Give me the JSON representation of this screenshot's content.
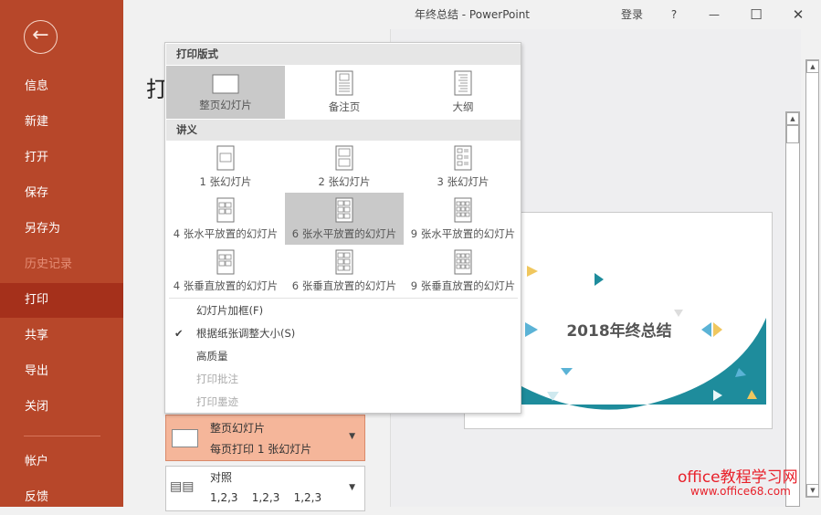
{
  "window": {
    "title": "年终总结  -  PowerPoint",
    "login": "登录",
    "help": "?",
    "minimize": "—",
    "maximize": "☐",
    "close": "✕"
  },
  "sidebar": {
    "back_icon": "arrow-left-icon",
    "items": [
      {
        "label": "信息",
        "state": "normal"
      },
      {
        "label": "新建",
        "state": "normal"
      },
      {
        "label": "打开",
        "state": "normal"
      },
      {
        "label": "保存",
        "state": "normal"
      },
      {
        "label": "另存为",
        "state": "normal"
      },
      {
        "label": "历史记录",
        "state": "disabled"
      },
      {
        "label": "打印",
        "state": "active"
      },
      {
        "label": "共享",
        "state": "normal"
      },
      {
        "label": "导出",
        "state": "normal"
      },
      {
        "label": "关闭",
        "state": "normal"
      }
    ],
    "bottom_items": [
      {
        "label": "帐户"
      },
      {
        "label": "反馈"
      }
    ]
  },
  "page_header": "打",
  "print_layout_menu": {
    "section1": "打印版式",
    "layouts": [
      {
        "label": "整页幻灯片",
        "icon": "full",
        "selected": true
      },
      {
        "label": "备注页",
        "icon": "notes",
        "selected": false
      },
      {
        "label": "大纲",
        "icon": "outline",
        "selected": false
      }
    ],
    "section2": "讲义",
    "handouts": [
      {
        "label": "1 张幻灯片",
        "icon": "h1",
        "selected": false
      },
      {
        "label": "2 张幻灯片",
        "icon": "h2",
        "selected": false
      },
      {
        "label": "3 张幻灯片",
        "icon": "h3",
        "selected": false
      },
      {
        "label": "4 张水平放置的幻灯片",
        "icon": "h4",
        "selected": false
      },
      {
        "label": "6 张水平放置的幻灯片",
        "icon": "h6",
        "selected": true
      },
      {
        "label": "9 张水平放置的幻灯片",
        "icon": "h9",
        "selected": false
      },
      {
        "label": "4 张垂直放置的幻灯片",
        "icon": "h4",
        "selected": false
      },
      {
        "label": "6 张垂直放置的幻灯片",
        "icon": "h6",
        "selected": false
      },
      {
        "label": "9 张垂直放置的幻灯片",
        "icon": "h9",
        "selected": false
      }
    ],
    "options": [
      {
        "label": "幻灯片加框(F)",
        "checked": false,
        "enabled": true
      },
      {
        "label": "根据纸张调整大小(S)",
        "checked": true,
        "enabled": true
      },
      {
        "label": "高质量",
        "checked": false,
        "enabled": true
      },
      {
        "label": "打印批注",
        "checked": false,
        "enabled": false
      },
      {
        "label": "打印墨迹",
        "checked": false,
        "enabled": false
      }
    ],
    "check_glyph": "✔"
  },
  "layout_dropdown": {
    "title": "整页幻灯片",
    "subtitle": "每页打印 1 张幻灯片"
  },
  "collate_dropdown": {
    "title": "对照",
    "subtitle": "1,2,3    1,2,3    1,2,3"
  },
  "slide": {
    "title": "2018年终总结",
    "accent": "#1e8c9c"
  },
  "watermark": {
    "line1": "office教程学习网",
    "line2": "www.office68.com"
  }
}
